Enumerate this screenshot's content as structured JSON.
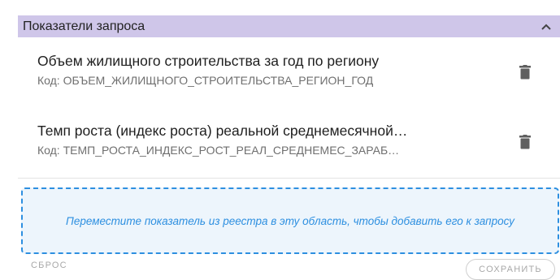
{
  "panel": {
    "title": "Показатели запроса",
    "collapse_icon": "chevron-up-icon"
  },
  "items": [
    {
      "title": "Объем жилищного строительства за год по региону",
      "code": "Код: ОБЪЕМ_ЖИЛИЩНОГО_СТРОИТЕЛЬСТВА_РЕГИОН_ГОД",
      "delete_icon": "trash-icon"
    },
    {
      "title": "Темп роста (индекс роста) реальной среднемесячной…",
      "code": "Код: ТЕМП_РОСТА_ИНДЕКС_РОСТ_РЕАЛ_СРЕДНЕМЕС_ЗАРАБ…",
      "delete_icon": "trash-icon"
    }
  ],
  "dropzone": {
    "text": "Переместите показатель из реестра в эту область, чтобы добавить его к запросу"
  },
  "actions": {
    "reset_label": "СБРОС",
    "save_label": "СОХРАНИТЬ"
  },
  "colors": {
    "header_bg": "#cfc6e9",
    "dropzone_accent": "#2d8fe0"
  }
}
